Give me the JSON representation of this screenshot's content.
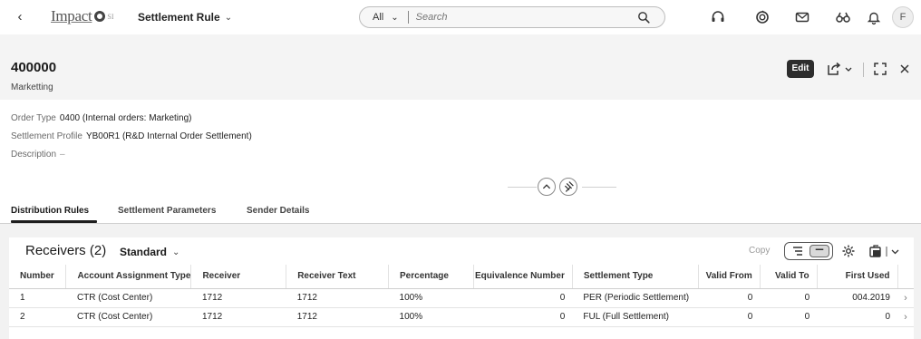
{
  "shell": {
    "logo_text": "Impact",
    "logo_sup": "SI",
    "app_title": "Settlement Rule",
    "search_scope": "All",
    "search_placeholder": "Search",
    "avatar_initial": "F"
  },
  "header": {
    "title": "400000",
    "subtitle": "Marketting",
    "edit_label": "Edit"
  },
  "fields": [
    {
      "label": "Order Type",
      "value": "0400 (Internal orders: Marketing)"
    },
    {
      "label": "Settlement Profile",
      "value": "YB00R1 (R&D Internal Order Settlement)"
    },
    {
      "label": "Description",
      "value": "–"
    }
  ],
  "tabs": [
    {
      "label": "Distribution Rules",
      "active": true
    },
    {
      "label": "Settlement Parameters",
      "active": false
    },
    {
      "label": "Sender Details",
      "active": false
    }
  ],
  "table": {
    "title": "Receivers (2)",
    "variant": "Standard",
    "copy_label": "Copy",
    "columns": [
      "Number",
      "Account Assignment Type",
      "Receiver",
      "Receiver Text",
      "Percentage",
      "Equivalence Number",
      "Settlement Type",
      "Valid From",
      "Valid To",
      "First Used"
    ],
    "rows": [
      [
        "1",
        "CTR (Cost Center)",
        "1712",
        "1712",
        "100%",
        "0",
        "PER (Periodic Settlement)",
        "0",
        "0",
        "004.2019"
      ],
      [
        "2",
        "CTR (Cost Center)",
        "1712",
        "1712",
        "100%",
        "0",
        "FUL (Full Settlement)",
        "0",
        "0",
        "0"
      ]
    ]
  }
}
